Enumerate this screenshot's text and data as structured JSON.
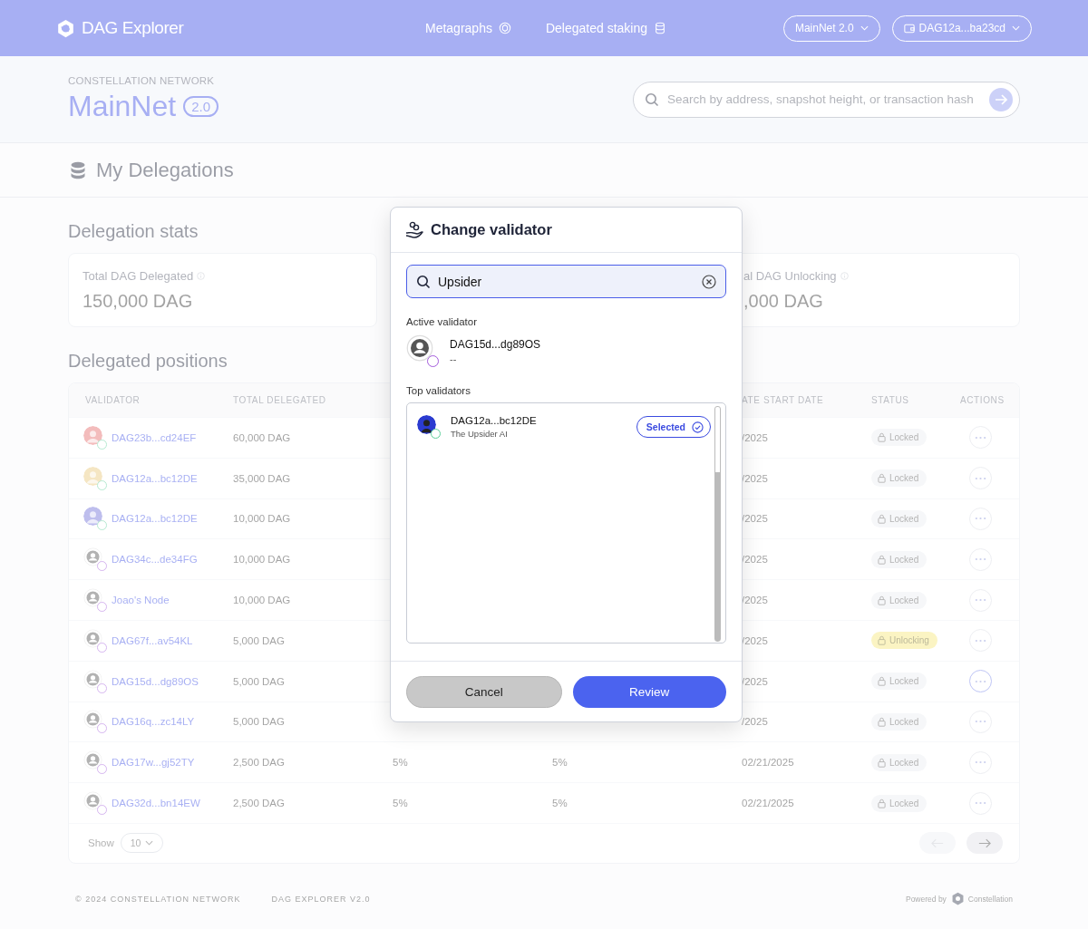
{
  "nav": {
    "logo": "DAG Explorer",
    "links": [
      {
        "label": "Metagraphs"
      },
      {
        "label": "Delegated staking"
      }
    ],
    "network_select": "MainNet 2.0",
    "wallet_select": "DAG12a...ba23cd"
  },
  "hero": {
    "eyebrow": "CONSTELLATION NETWORK",
    "title": "MainNet",
    "badge": "2.0",
    "search": {
      "placeholder": "Search by address, snapshot height, or transaction hash"
    }
  },
  "page_title": "My Delegations",
  "stats": {
    "title": "Delegation stats",
    "cards": [
      {
        "label": "Total DAG Delegated",
        "value": "150,000 DAG"
      },
      {
        "label": "al DAG Unlocking",
        "value": ",000 DAG"
      }
    ]
  },
  "positions": {
    "title": "Delegated positions",
    "columns": [
      "VALIDATOR",
      "TOTAL DELEGATED",
      "ATE START DATE",
      "STATUS",
      "ACTIONS"
    ],
    "rows": [
      {
        "validator": "DAG23b...cd24EF",
        "total": "60,000 DAG",
        "date": "/2025",
        "status": {
          "kind": "locked",
          "label": "Locked"
        },
        "selected": false
      },
      {
        "validator": "DAG12a...bc12DE",
        "total": "35,000 DAG",
        "date": "/2025",
        "status": {
          "kind": "locked",
          "label": "Locked"
        },
        "selected": false
      },
      {
        "validator": "DAG12a...bc12DE",
        "total": "10,000 DAG",
        "date": "/2025",
        "status": {
          "kind": "locked",
          "label": "Locked"
        },
        "selected": false
      },
      {
        "avatar": {
          "kind": "default"
        },
        "validator": "DAG34c...de34FG",
        "total": "10,000 DAG",
        "date": "/2025",
        "status": {
          "kind": "locked",
          "label": "Locked"
        },
        "selected": false
      },
      {
        "avatar": {
          "kind": "default"
        },
        "validator": "Joao's Node",
        "total": "10,000 DAG",
        "date": "/2025",
        "status": {
          "kind": "locked",
          "label": "Locked"
        },
        "selected": false
      },
      {
        "avatar": {
          "kind": "default"
        },
        "validator": "DAG67f...av54KL",
        "total": "5,000 DAG",
        "date": "/2025",
        "status": {
          "kind": "unlocking",
          "label": "Unlocking"
        },
        "selected": false
      },
      {
        "avatar": {
          "kind": "default"
        },
        "validator": "DAG15d...dg89OS",
        "total": "5,000 DAG",
        "date": "/2025",
        "status": {
          "kind": "locked",
          "label": "Locked"
        },
        "selected": true
      },
      {
        "avatar": {
          "kind": "default"
        },
        "validator": "DAG16q...zc14LY",
        "total": "5,000 DAG",
        "date": "/2025",
        "status": {
          "kind": "locked",
          "label": "Locked"
        },
        "selected": false
      },
      {
        "avatar": {
          "kind": "default"
        },
        "validator": "DAG17w...gj52TY",
        "total": "2,500 DAG",
        "column_3": "5%",
        "column_4": "5%",
        "date": "02/21/2025",
        "status": {
          "kind": "locked",
          "label": "Locked"
        },
        "selected": false
      },
      {
        "avatar": {
          "kind": "default"
        },
        "validator": "DAG32d...bn14EW",
        "total": "2,500 DAG",
        "column_3": "5%",
        "column_4": "5%",
        "date": "02/21/2025",
        "status": {
          "kind": "locked",
          "label": "Locked"
        },
        "selected": false
      }
    ],
    "show_label": "Show",
    "page_size": "10",
    "prev_disabled": true,
    "next_disabled": false
  },
  "modal": {
    "title": "Change validator",
    "search": {
      "value": "Upsider"
    },
    "active_label": "Active validator",
    "active": {
      "name": "DAG15d...dg89OS",
      "sub": "--",
      "avatar": {
        "kind": "default"
      }
    },
    "top_label": "Top validators",
    "top": [
      {
        "name": "DAG12a...bc12DE",
        "sub": "The Upsider AI",
        "selected": true,
        "selected_label": "Selected"
      }
    ],
    "cancel": "Cancel",
    "review": "Review"
  },
  "footer": {
    "copyright": "© 2024 CONSTELLATION NETWORK",
    "version": "DAG EXPLORER V2.0",
    "powered": "Powered by",
    "brand": "Constellation"
  }
}
